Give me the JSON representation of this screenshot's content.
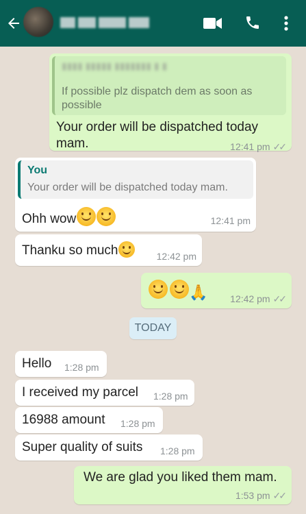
{
  "header": {
    "back_icon": "arrow-left-icon",
    "contact_name": "▮▮▮▮▮ ▮▮▮▮▮ ▮▮▮▮▮ ...",
    "icons": [
      "video-call-icon",
      "phone-icon",
      "more-vert-icon"
    ]
  },
  "messages": {
    "m1": {
      "quote_author": "▮▮▮▮ ▮▮▮▮▮ ▮▮▮▮▮▮▮ ▮ ▮",
      "quote_text": "If possible plz dispatch dem as soon as possible",
      "text": "Your order will be dispatched today mam.",
      "time": "12:41 pm"
    },
    "m2": {
      "quote_author": "You",
      "quote_text": "Your order will be dispatched today mam.",
      "text": "Ohh wow",
      "time": "12:41 pm"
    },
    "m3": {
      "text": "Thanku so much",
      "time": "12:42 pm"
    },
    "m4": {
      "time": "12:42 pm"
    },
    "date_divider": "TODAY",
    "m5": {
      "text": "Hello",
      "time": "1:28 pm"
    },
    "m6": {
      "text": "I received my parcel",
      "time": "1:28 pm"
    },
    "m7": {
      "text": "16988 amount",
      "time": "1:28 pm"
    },
    "m8": {
      "text": "Super quality of suits",
      "time": "1:28 pm"
    },
    "m9": {
      "text": "We are glad you liked them mam.",
      "time": "1:53 pm"
    }
  },
  "colors": {
    "header": "#075e54",
    "outgoing_bubble": "#dcf8c6",
    "incoming_bubble": "#ffffff",
    "quote_accent_out": "#9fc48a",
    "quote_accent_in": "#0b7a72"
  }
}
